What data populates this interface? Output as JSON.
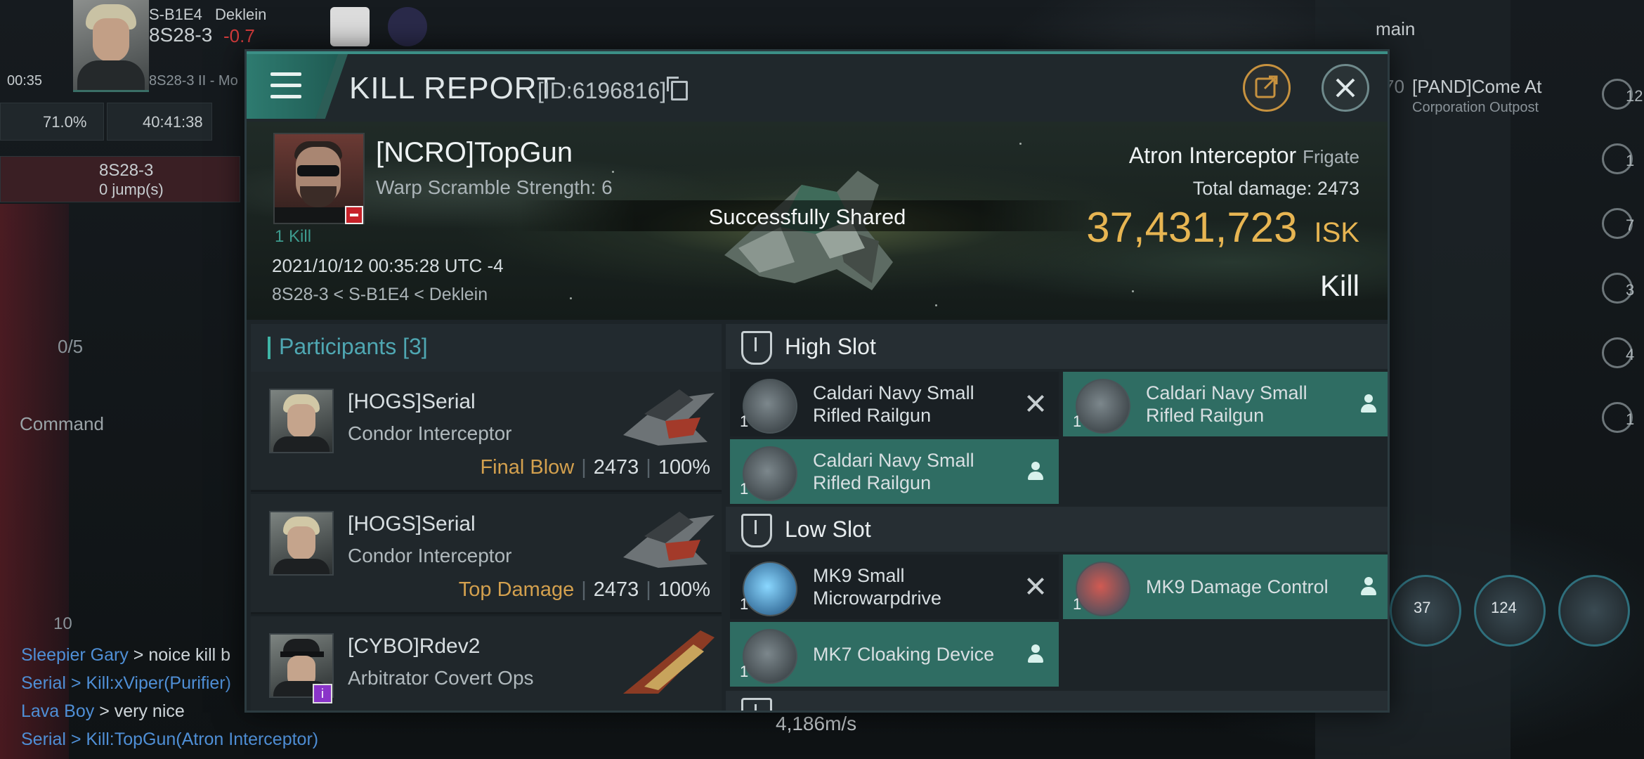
{
  "hud": {
    "system_path": "S-B1E4",
    "region": "Deklein",
    "current_system": "8S28-3",
    "security": "-0.7",
    "time": "00:35",
    "location_sub": "8S28-3 II - Mo",
    "shield_pct": "71.0%",
    "timer": "40:41:38",
    "nav_system": "8S28-3",
    "nav_sec": "-0.7",
    "jumps": "0 jump(s)",
    "fleet_count": "0/5",
    "command_label": "Command",
    "mail_count": "10",
    "speed": "4,186m/s",
    "channel_label": "main",
    "local_entry_num": "70",
    "local_entry_name": "[PAND]Come At",
    "local_entry_sub": "Corporation Outpost",
    "module_counts": [
      "37",
      "124"
    ],
    "right_counts": [
      "12",
      "1",
      "7",
      "3",
      "4",
      "1"
    ]
  },
  "chat": [
    {
      "who": "Sleepier Gary",
      "msg": " > noice kill b"
    },
    {
      "who": "Serial",
      "msg": " > Kill:xViper(Purifier)"
    },
    {
      "who": "Lava Boy",
      "msg": " > very nice"
    },
    {
      "who": "Serial",
      "msg": " > Kill:TopGun(Atron Interceptor)"
    }
  ],
  "report": {
    "title": "KILL REPORT",
    "id_label": "[ID:6196816]",
    "victim_name": "[NCRO]TopGun",
    "victim_sub": "Warp Scramble Strength: 6",
    "kill_count": "1 Kill",
    "datetime": "2021/10/12 00:35:28 UTC -4",
    "location": "8S28-3 < S-B1E4 < Deklein",
    "shared_text": "Successfully Shared",
    "ship_name": "Atron Interceptor",
    "ship_class": "Frigate",
    "total_damage_label": "Total damage:",
    "total_damage": "2473",
    "isk_value": "37,431,723",
    "isk_unit": "ISK",
    "result": "Kill"
  },
  "participants": {
    "header": "Participants [3]",
    "rows": [
      {
        "name": "[HOGS]Serial",
        "ship": "Condor Interceptor",
        "tag": "Final Blow",
        "damage": "2473",
        "pct": "100%"
      },
      {
        "name": "[HOGS]Serial",
        "ship": "Condor Interceptor",
        "tag": "Top Damage",
        "damage": "2473",
        "pct": "100%"
      },
      {
        "name": "[CYBO]Rdev2",
        "ship": "Arbitrator Covert Ops",
        "tag": "",
        "damage": "",
        "pct": ""
      }
    ]
  },
  "slots": {
    "high_label": "High Slot",
    "low_label": "Low Slot",
    "high": [
      {
        "name": "Caldari Navy Small Rifled Railgun",
        "qty": "1",
        "status": "destroyed"
      },
      {
        "name": "Caldari Navy Small Rifled Railgun",
        "qty": "1",
        "status": "dropped"
      },
      {
        "name": "Caldari Navy Small Rifled Railgun",
        "qty": "1",
        "status": "dropped"
      }
    ],
    "low": [
      {
        "name": "MK9 Small Microwarpdrive",
        "qty": "1",
        "status": "destroyed"
      },
      {
        "name": "MK9 Damage Control",
        "qty": "1",
        "status": "dropped"
      },
      {
        "name": "MK7 Cloaking Device",
        "qty": "1",
        "status": "dropped"
      }
    ]
  },
  "colors": {
    "accent": "#3b8f86",
    "isk": "#e7b552",
    "dropped_bg": "#2f6d63",
    "tag": "#d3a04e"
  }
}
